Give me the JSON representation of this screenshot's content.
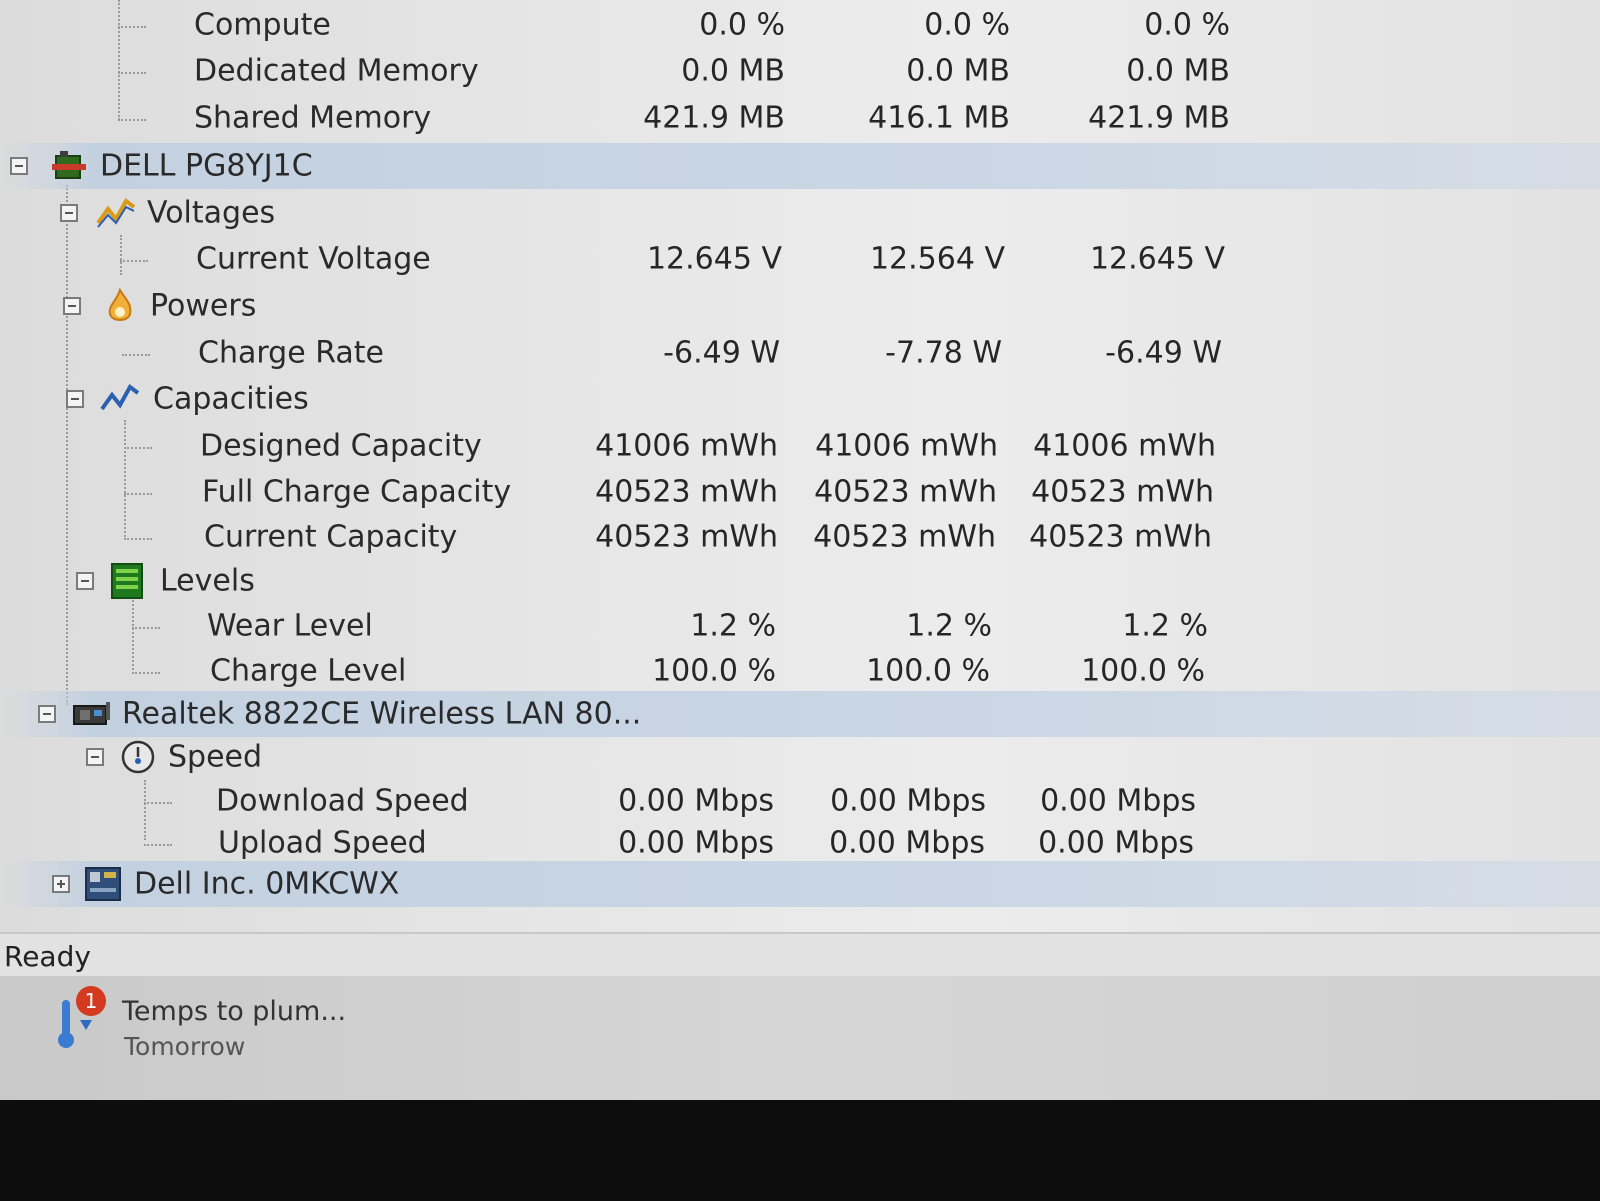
{
  "tree": {
    "gpu_rows": [
      {
        "label": "Compute",
        "values": [
          "0.0 %",
          "0.0 %",
          "0.0 %"
        ]
      },
      {
        "label": "Dedicated Memory",
        "values": [
          "0.0 MB",
          "0.0 MB",
          "0.0 MB"
        ]
      },
      {
        "label": "Shared Memory",
        "values": [
          "421.9 MB",
          "416.1 MB",
          "421.9 MB"
        ]
      }
    ],
    "battery": {
      "name": "DELL PG8YJ1C",
      "voltages": {
        "label": "Voltages",
        "rows": [
          {
            "label": "Current Voltage",
            "values": [
              "12.645 V",
              "12.564 V",
              "12.645 V"
            ]
          }
        ]
      },
      "powers": {
        "label": "Powers",
        "rows": [
          {
            "label": "Charge Rate",
            "values": [
              "-6.49 W",
              "-7.78 W",
              "-6.49 W"
            ]
          }
        ]
      },
      "capacities": {
        "label": "Capacities",
        "rows": [
          {
            "label": "Designed Capacity",
            "values": [
              "41006 mWh",
              "41006 mWh",
              "41006 mWh"
            ]
          },
          {
            "label": "Full Charge Capacity",
            "values": [
              "40523 mWh",
              "40523 mWh",
              "40523 mWh"
            ]
          },
          {
            "label": "Current Capacity",
            "values": [
              "40523 mWh",
              "40523 mWh",
              "40523 mWh"
            ]
          }
        ]
      },
      "levels": {
        "label": "Levels",
        "rows": [
          {
            "label": "Wear Level",
            "values": [
              "1.2 %",
              "1.2 %",
              "1.2 %"
            ]
          },
          {
            "label": "Charge Level",
            "values": [
              "100.0 %",
              "100.0 %",
              "100.0 %"
            ]
          }
        ]
      }
    },
    "network": {
      "name": "Realtek 8822CE Wireless LAN 80...",
      "speed": {
        "label": "Speed",
        "rows": [
          {
            "label": "Download Speed",
            "values": [
              "0.00 Mbps",
              "0.00 Mbps",
              "0.00 Mbps"
            ]
          },
          {
            "label": "Upload Speed",
            "values": [
              "0.00 Mbps",
              "0.00 Mbps",
              "0.00 Mbps"
            ]
          }
        ]
      }
    },
    "mainboard": {
      "name": "Dell Inc. 0MKCWX"
    }
  },
  "status": {
    "text": "Ready"
  },
  "notification": {
    "title": "Temps to plum...",
    "subtitle": "Tomorrow",
    "badge": "1"
  },
  "colors": {
    "badge": "#d33a1f",
    "device_row": "#c6d4e4"
  }
}
